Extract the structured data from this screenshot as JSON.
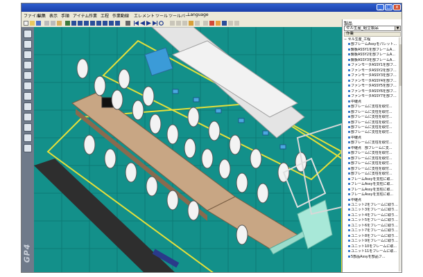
{
  "window": {
    "minimize": "_",
    "maximize": "□",
    "close": "x"
  },
  "menu": [
    "ファイル",
    "編集",
    "表示",
    "手順",
    "アイテム",
    "作業",
    "工程",
    "作業動線",
    "エレメント",
    "ツール",
    "ツールバー",
    "Language"
  ],
  "left_tool_icons": [
    "select-icon",
    "rotate-icon",
    "move-icon",
    "worker-icon",
    "product-icon",
    "table-icon",
    "chart-icon",
    "camera-icon",
    "grid-icon",
    "measure-icon",
    "cylinder-icon",
    "box-icon"
  ],
  "brand_watermark": "GP4",
  "panel": {
    "title": "製品",
    "select_value": "セル生産_組立製品",
    "header": "作業",
    "root_item": "セル生産_工程",
    "items": [
      "部フレームAssyをパレット...",
      "鋼板ASSY1を部フレームA...",
      "鋼板ASSY2を部フレームA...",
      "鋼板ASSY3を部フレームA...",
      "ファンモータASSY1を部フ...",
      "ファンモータASSY2を部フ...",
      "ファンモータASSY3を部フ...",
      "ファンモータASSY4を部フ...",
      "ファンモータASSY5を部フ...",
      "ファンモータASSY6を部フ...",
      "ファンモータASSY7を部フ...",
      "中継点",
      "部フレームに支柱を取付...",
      "部フレームに支柱を取付...",
      "部フレームに支柱を取付...",
      "部フレームに支柱を取付...",
      "部フレームに支柱を取付...",
      "部フレームに支柱を取付...",
      "中継点",
      "部フレームに支柱を取付...",
      "中継点　部フレームに支...",
      "部フレームに支柱を取付...",
      "部フレームに支柱を取付...",
      "部フレームに支柱を取付...",
      "部フレームに支柱を取付...",
      "部フレームに支柱を取付...",
      "フレームAssyを支柱に取...",
      "フレームAssyを支柱に取...",
      "フレームAssyを支柱に取...",
      "フレームAssyを支柱に取...",
      "中継点",
      "ユニット2をフレームに取り...",
      "ユニット3をフレームに取り...",
      "ユニット4をフレームに取り...",
      "ユニット5をフレームに取り...",
      "ユニット6をフレームに取り...",
      "ユニット7をフレームに取り...",
      "ユニット8をフレームに取り...",
      "ユニット9をフレームに取り...",
      "ユニット10をフレームに取...",
      "ユニット11をフレームに取...",
      "5部品Assyを部品フ..."
    ]
  }
}
